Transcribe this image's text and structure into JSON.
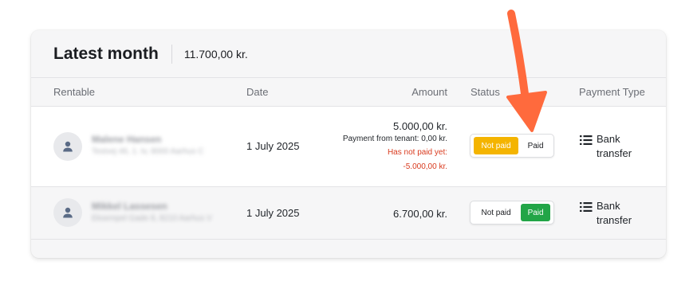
{
  "card": {
    "title": "Latest month",
    "total": "11.700,00 kr."
  },
  "columns": {
    "rentable": "Rentable",
    "date": "Date",
    "amount": "Amount",
    "status": "Status",
    "payment_type": "Payment Type"
  },
  "rows": [
    {
      "name": "Malene Hansen",
      "address": "Testvej 46, 1. tv, 8000 Aarhus C",
      "date": "1 July 2025",
      "amount": "5.000,00 kr.",
      "payment_from_tenant": "Payment from tenant: 0,00 kr.",
      "has_not_paid_label": "Has not paid yet:",
      "has_not_paid_amount": "-5.000,00 kr.",
      "status_not_paid": "Not paid",
      "status_paid": "Paid",
      "status_selected": "Not paid",
      "payment_type": "Bank transfer"
    },
    {
      "name": "Mikkel Lassesen",
      "address": "Eksempel Gade 8, 8210 Aarhus V",
      "date": "1 July 2025",
      "amount": "6.700,00 kr.",
      "status_not_paid": "Not paid",
      "status_paid": "Paid",
      "status_selected": "Paid",
      "payment_type": "Bank transfer"
    }
  ],
  "icons": {
    "avatar": "person-icon",
    "payment_type": "list-icon",
    "annotation": "arrow-annotation"
  },
  "colors": {
    "not_paid_active": "#f4b400",
    "paid_active": "#22a547",
    "due_text": "#d93a1e",
    "arrow": "#ff6a3d"
  }
}
